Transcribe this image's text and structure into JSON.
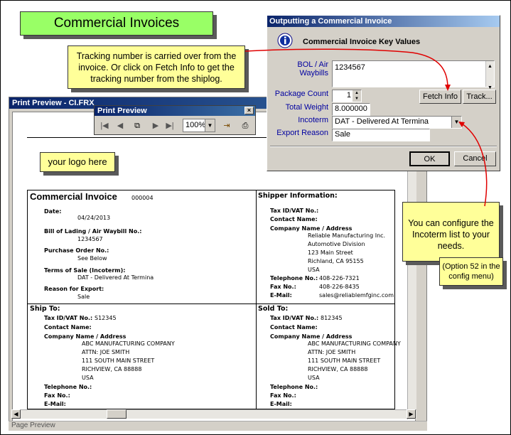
{
  "banner": {
    "title": "Commercial Invoices"
  },
  "callouts": {
    "tracking": "Tracking number is carried over from the invoice. Or click on Fetch Info to get the tracking number from the shiplog.",
    "incoterm": "You can configure the Incoterm list to your needs.",
    "option_note": "(Option 52 in the config menu)",
    "logo": "your logo here"
  },
  "print_preview": {
    "window_title": "Print Preview - CI.FRX",
    "toolbar_title": "Print Preview",
    "zoom": "100%",
    "status": "Page Preview"
  },
  "invoice": {
    "title": "Commercial Invoice",
    "number": "000004",
    "date_label": "Date:",
    "date": "04/24/2013",
    "bol_label": "Bill of Lading / Air Waybill No.:",
    "bol": "1234567",
    "po_label": "Purchase Order No.:",
    "po": "See Below",
    "terms_label": "Terms of Sale (Incoterm):",
    "terms": "DAT - Delivered At Termina",
    "reason_label": "Reason for Export:",
    "reason": "Sale",
    "shipper": {
      "header": "Shipper Information:",
      "tax_label": "Tax ID/VAT No.:",
      "contact_label": "Contact Name:",
      "company_label": "Company Name / Address",
      "lines": [
        "Reliable Manufacturing Inc.",
        "Automotive Division",
        "123 Main Street",
        "Richland, CA 95155",
        "USA"
      ],
      "phone_label": "Telephone No.:",
      "phone": "408-226-7321",
      "fax_label": "Fax No.:",
      "fax": "408-226-8435",
      "email_label": "E-Mail:",
      "email": "sales@reliablemfginc.com"
    },
    "ship_to": {
      "header": "Ship To:",
      "tax_label": "Tax ID/VAT No.:",
      "tax": "S12345",
      "contact_label": "Contact Name:",
      "company_label": "Company Name / Address",
      "lines": [
        "ABC MANUFACTURING COMPANY",
        "ATTN: JOE SMITH",
        "111 SOUTH MAIN STREET",
        "RICHVIEW, CA 88888",
        "USA"
      ],
      "phone_label": "Telephone No.:",
      "fax_label": "Fax No.:",
      "email_label": "E-Mail:"
    },
    "sold_to": {
      "header": "Sold To:",
      "tax_label": "Tax ID/VAT No.:",
      "tax": "812345",
      "contact_label": "Contact Name:",
      "company_label": "Company Name / Address",
      "lines": [
        "ABC MANUFACTURING COMPANY",
        "ATTN: JOE SMITH",
        "111 SOUTH MAIN STREET",
        "RICHVIEW, CA 88888",
        "USA"
      ],
      "phone_label": "Telephone No.:",
      "fax_label": "Fax No.:",
      "email_label": "E-Mail:"
    }
  },
  "dialog": {
    "title": "Outputting a Commercial Invoice",
    "heading": "Commercial Invoice Key Values",
    "bol_label": "BOL / Air Waybills",
    "bol_value": "1234567",
    "package_label": "Package Count",
    "package_value": "1",
    "weight_label": "Total Weight",
    "weight_value": "8.000000",
    "incoterm_label": "Incoterm",
    "incoterm_value": "DAT - Delivered At Termina",
    "reason_label": "Export Reason",
    "reason_value": "Sale",
    "fetch_button": "Fetch Info",
    "track_button": "Track...",
    "ok_button": "OK",
    "cancel_button": "Cancel"
  },
  "colors": {
    "banner": "#99ff66",
    "callout": "#ffff99",
    "arrow": "#e00000",
    "titlebar": "#0a246a"
  }
}
